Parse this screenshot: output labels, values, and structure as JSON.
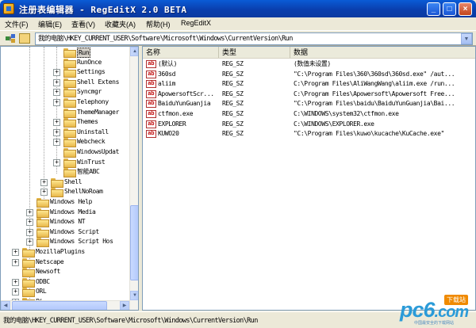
{
  "window": {
    "title": "注册表编辑器 - RegEditX 2.0 BETA",
    "minimize": "_",
    "maximize": "□",
    "close": "×"
  },
  "menu": [
    "文件(F)",
    "编辑(E)",
    "查看(V)",
    "收藏夹(A)",
    "帮助(H)",
    "RegEditX"
  ],
  "address": {
    "path": "我的电脑\\HKEY_CURRENT_USER\\Software\\Microsoft\\Windows\\CurrentVersion\\Run"
  },
  "tree": [
    {
      "label": "Run",
      "selected": true
    },
    {
      "label": "RunOnce"
    },
    {
      "label": "Settings"
    },
    {
      "label": "Shell Extens"
    },
    {
      "label": "Syncmgr"
    },
    {
      "label": "Telephony"
    },
    {
      "label": "ThemeManager"
    },
    {
      "label": "Themes"
    },
    {
      "label": "Uninstall"
    },
    {
      "label": "Webcheck"
    },
    {
      "label": "WindowsUpdat"
    },
    {
      "label": "WinTrust"
    },
    {
      "label": "智能ABC"
    },
    {
      "label": "Shell"
    },
    {
      "label": "ShellNoRoam"
    },
    {
      "label": "Windows Help"
    },
    {
      "label": "Windows Media"
    },
    {
      "label": "Windows NT"
    },
    {
      "label": "Windows Script"
    },
    {
      "label": "Windows Script Hos"
    },
    {
      "label": "MozillaPlugins"
    },
    {
      "label": "Netscape"
    },
    {
      "label": "Newsoft"
    },
    {
      "label": "ODBC"
    },
    {
      "label": "ORL"
    },
    {
      "label": "Pi..."
    }
  ],
  "list": {
    "columns": [
      "名称",
      "类型",
      "数据"
    ],
    "rows": [
      {
        "name": "(默认)",
        "type": "REG_SZ",
        "data": "(数值未设置)"
      },
      {
        "name": "360sd",
        "type": "REG_SZ",
        "data": "\"C:\\Program Files\\360\\360sd\\360sd.exe\" /aut..."
      },
      {
        "name": "aliim",
        "type": "REG_SZ",
        "data": "C:\\Program Files\\AliWangWang\\aliim.exe /run..."
      },
      {
        "name": "ApowersoftScr...",
        "type": "REG_SZ",
        "data": "C:\\Program Files\\Apowersoft\\Apowersoft Free..."
      },
      {
        "name": "BaiduYunGuanjia",
        "type": "REG_SZ",
        "data": "\"C:\\Program Files\\baidu\\BaiduYunGuanjia\\Bai..."
      },
      {
        "name": "ctfmon.exe",
        "type": "REG_SZ",
        "data": "C:\\WINDOWS\\system32\\ctfmon.exe"
      },
      {
        "name": "EXPLORER",
        "type": "REG_SZ",
        "data": "C:\\WINDOWS\\EXPLORER.exe"
      },
      {
        "name": "KUWO20",
        "type": "REG_SZ",
        "data": "\"C:\\Program Files\\kuwo\\kucache\\KuCache.exe\""
      }
    ],
    "value_icon": "ab"
  },
  "status": {
    "text": "我的电脑\\HKEY_CURRENT_USER\\Software\\Microsoft\\Windows\\CurrentVersion\\Run"
  },
  "watermark": {
    "main": "pc6",
    "suffix": ".com",
    "badge": "下载站",
    "sub": "中国最安全的下载网站"
  }
}
